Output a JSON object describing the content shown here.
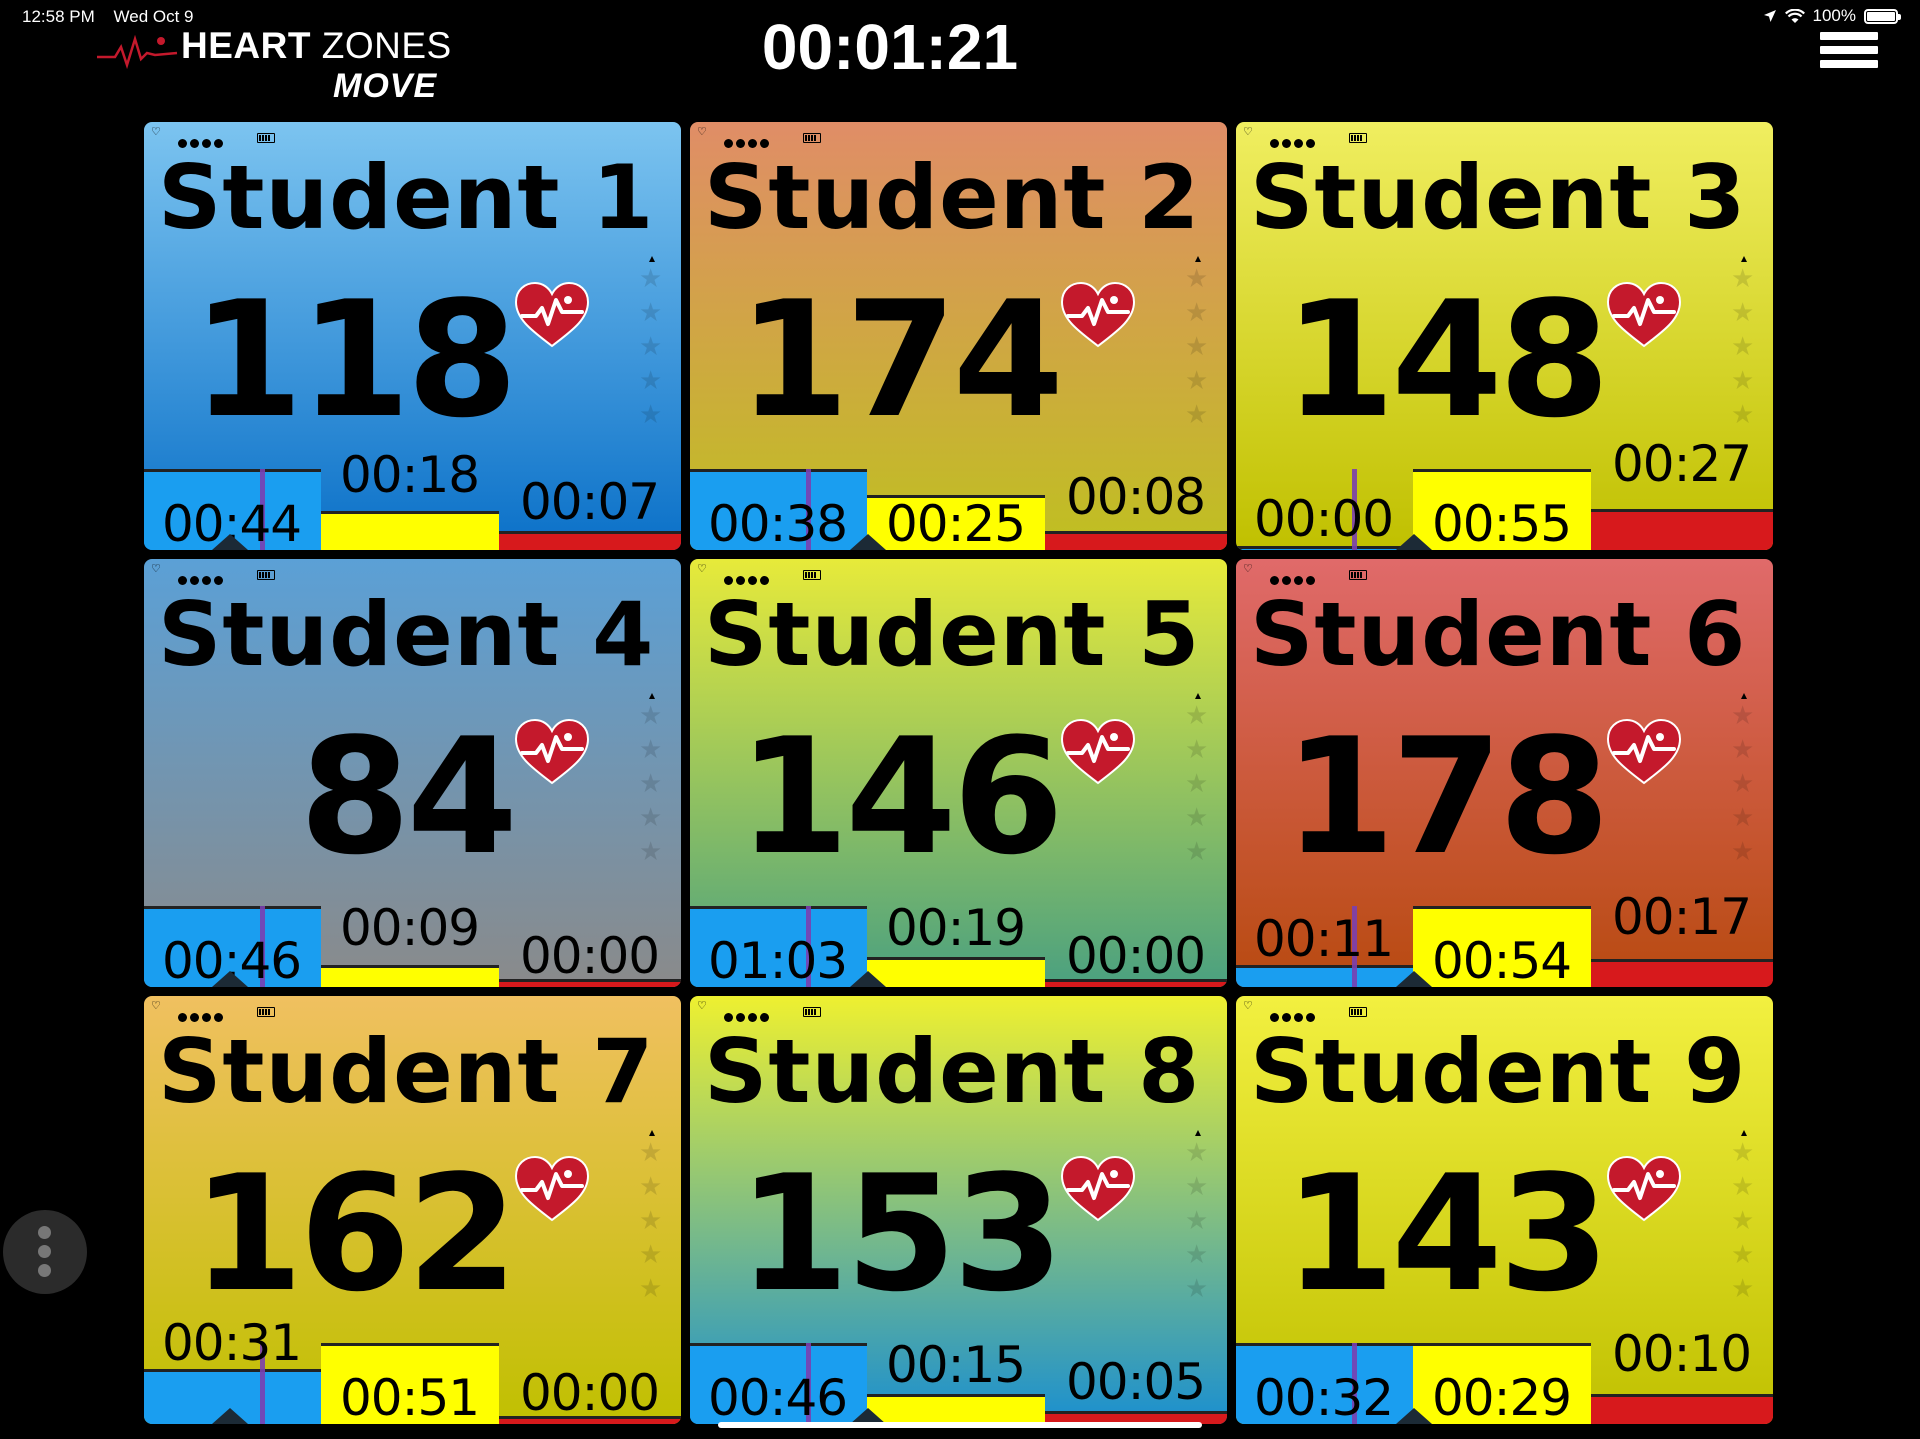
{
  "status_bar": {
    "time": "12:58 PM",
    "date": "Wed Oct 9",
    "battery": "100%"
  },
  "app": {
    "brand_bold": "HEART",
    "brand_light": " ZONES",
    "sub": "MOVE"
  },
  "session_timer": "00:01:21",
  "colors": {
    "zone_blue": "#1a9ef0",
    "zone_yellow": "#ffff00",
    "zone_red": "#d7191c",
    "heart": "#c4192c",
    "background": "#000000"
  },
  "tiles": [
    {
      "name": "Student 1 #",
      "bpm": "118",
      "top_color": "#7cc4f0",
      "bottom_color": "#0a70c8",
      "times": [
        "00:44",
        "00:18",
        "00:07"
      ],
      "zone_levels": [
        0.74,
        0.35,
        0.17
      ],
      "label_levels": [
        0.05,
        0.5,
        0.25
      ]
    },
    {
      "name": "Student 2 #",
      "bpm": "174",
      "top_color": "#e08d67",
      "bottom_color": "#bfc020",
      "times": [
        "00:38",
        "00:25",
        "00:08"
      ],
      "zone_levels": [
        0.74,
        0.5,
        0.17
      ],
      "label_levels": [
        0.05,
        0.05,
        0.3
      ]
    },
    {
      "name": "Student 3 #",
      "bpm": "148",
      "top_color": "#f0ee60",
      "bottom_color": "#c0c000",
      "times": [
        "00:00",
        "00:55",
        "00:27"
      ],
      "zone_levels": [
        0.04,
        0.74,
        0.37
      ],
      "label_levels": [
        0.1,
        0.05,
        0.6
      ]
    },
    {
      "name": "Student 4 #",
      "bpm": "84",
      "top_color": "#5ba0d6",
      "bottom_color": "#8a8a8a",
      "times": [
        "00:46",
        "00:09",
        "00:00"
      ],
      "zone_levels": [
        0.74,
        0.2,
        0.07
      ],
      "label_levels": [
        0.05,
        0.35,
        0.1
      ]
    },
    {
      "name": "Student 5 #",
      "bpm": "146",
      "top_color": "#e7ea3a",
      "bottom_color": "#4aa080",
      "times": [
        "01:03",
        "00:19",
        "00:00"
      ],
      "zone_levels": [
        0.74,
        0.27,
        0.07
      ],
      "label_levels": [
        0.05,
        0.35,
        0.1
      ]
    },
    {
      "name": "Student 6 #",
      "bpm": "178",
      "top_color": "#e06a6a",
      "bottom_color": "#b84a10",
      "times": [
        "00:11",
        "00:54",
        "00:17"
      ],
      "zone_levels": [
        0.2,
        0.74,
        0.25
      ],
      "label_levels": [
        0.25,
        0.05,
        0.45
      ]
    },
    {
      "name": "Student 7 #",
      "bpm": "162",
      "top_color": "#f0c060",
      "bottom_color": "#c0c000",
      "times": [
        "00:31",
        "00:51",
        "00:00"
      ],
      "zone_levels": [
        0.5,
        0.74,
        0.07
      ],
      "label_levels": [
        0.55,
        0.05,
        0.1
      ]
    },
    {
      "name": "Student 8 #",
      "bpm": "153",
      "top_color": "#eef030",
      "bottom_color": "#1a8fd0",
      "times": [
        "00:46",
        "00:15",
        "00:05"
      ],
      "zone_levels": [
        0.74,
        0.27,
        0.12
      ],
      "label_levels": [
        0.05,
        0.35,
        0.2
      ]
    },
    {
      "name": "Student 9 #",
      "bpm": "143",
      "top_color": "#f2f040",
      "bottom_color": "#c0c000",
      "times": [
        "00:32",
        "00:29",
        "00:10"
      ],
      "zone_levels": [
        0.74,
        0.74,
        0.27
      ],
      "label_levels": [
        0.05,
        0.05,
        0.45
      ]
    }
  ]
}
